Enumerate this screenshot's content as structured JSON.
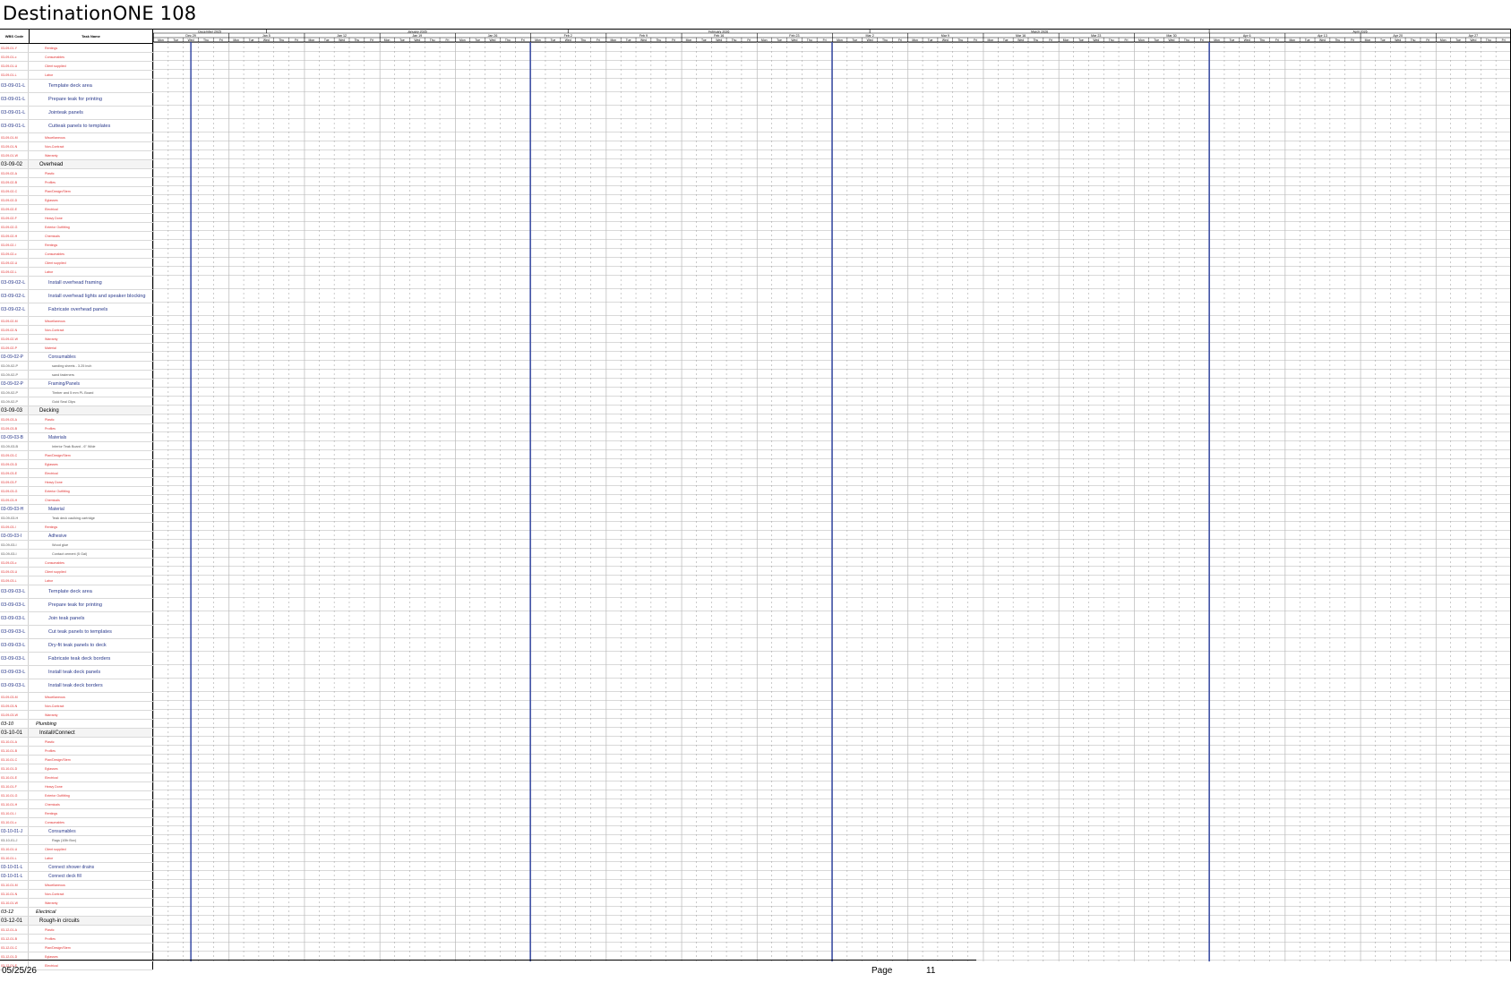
{
  "page_title": "DestinationONE 108",
  "left_header": {
    "wbs": "WBS Code",
    "task": "Task Name"
  },
  "rows": [
    {
      "wbs": "03-09-01-Y",
      "task": "Rentings",
      "style": "red"
    },
    {
      "wbs": "03-09-01-c",
      "task": "Consumables",
      "style": "red"
    },
    {
      "wbs": "03-09-01-U",
      "task": "Client supplied",
      "style": "red"
    },
    {
      "wbs": "03-09-01-L",
      "task": "Labor",
      "style": "red"
    },
    {
      "wbs": "03-09-01-L",
      "task": "Template deck area",
      "style": "blue"
    },
    {
      "wbs": "03-09-01-L",
      "task": "Prepare teak for printing",
      "style": "blue"
    },
    {
      "wbs": "03-09-01-L",
      "task": "Jointeak panels",
      "style": "blue"
    },
    {
      "wbs": "03-09-01-L",
      "task": "Cutteak panels to templates",
      "style": "blue"
    },
    {
      "wbs": "03-09-01-M",
      "task": "Miscellaneous",
      "style": "red"
    },
    {
      "wbs": "03-09-01-N",
      "task": "Non-Contract",
      "style": "red"
    },
    {
      "wbs": "03-09-01-W",
      "task": "Warranty",
      "style": "red"
    },
    {
      "wbs": "03-09-02",
      "task": "Overhead",
      "style": "head"
    },
    {
      "wbs": "03-09-02-A",
      "task": "Plastic",
      "style": "red"
    },
    {
      "wbs": "03-09-02-B",
      "task": "Profiles",
      "style": "red"
    },
    {
      "wbs": "03-09-02-C",
      "task": "Plan/Design/Stem",
      "style": "red"
    },
    {
      "wbs": "03-09-02-D",
      "task": "Eglasses",
      "style": "red"
    },
    {
      "wbs": "03-09-02-E",
      "task": "Electrical",
      "style": "red"
    },
    {
      "wbs": "03-09-02-F",
      "task": "Heavy Done",
      "style": "red"
    },
    {
      "wbs": "03-09-02-G",
      "task": "Exterior Outfitting",
      "style": "red"
    },
    {
      "wbs": "03-09-02-H",
      "task": "Chemicals",
      "style": "red"
    },
    {
      "wbs": "03-09-02-I",
      "task": "Rentings",
      "style": "red"
    },
    {
      "wbs": "03-09-02-c",
      "task": "Consumables",
      "style": "red"
    },
    {
      "wbs": "03-09-02-U",
      "task": "Client supplied",
      "style": "red"
    },
    {
      "wbs": "03-09-02-L",
      "task": "Labor",
      "style": "red"
    },
    {
      "wbs": "03-09-02-L",
      "task": "Install overhead framing",
      "style": "blue"
    },
    {
      "wbs": "03-09-02-L",
      "task": "Install overhead lights and speaker blocking",
      "style": "blue"
    },
    {
      "wbs": "03-09-02-L",
      "task": "Fabricate overhead panels",
      "style": "blue"
    },
    {
      "wbs": "03-09-02-M",
      "task": "Miscellaneous",
      "style": "red"
    },
    {
      "wbs": "03-09-02-N",
      "task": "Non-Contract",
      "style": "red"
    },
    {
      "wbs": "03-09-02-W",
      "task": "Warranty",
      "style": "red"
    },
    {
      "wbs": "03-09-02-P",
      "task": "Material",
      "style": "red"
    },
    {
      "wbs": "03-09-02-P",
      "task": "Consumables",
      "style": "group"
    },
    {
      "wbs": "03-09-02-P",
      "task": "sanding sheets - 3.25 inch",
      "style": "sub"
    },
    {
      "wbs": "03-09-02-P",
      "task": "sand fasteners",
      "style": "sub"
    },
    {
      "wbs": "03-09-02-P",
      "task": "Framing/Panels",
      "style": "group"
    },
    {
      "wbs": "03-09-02-P",
      "task": "Timber and 5 mm PL Board",
      "style": "sub"
    },
    {
      "wbs": "03-09-02-P",
      "task": "Gold Seal Clips",
      "style": "sub"
    },
    {
      "wbs": "03-09-03",
      "task": "Decking",
      "style": "head"
    },
    {
      "wbs": "03-09-03-A",
      "task": "Plastic",
      "style": "red"
    },
    {
      "wbs": "03-09-03-B",
      "task": "Profiles",
      "style": "red"
    },
    {
      "wbs": "03-09-03-B",
      "task": "Materials",
      "style": "group"
    },
    {
      "wbs": "03-09-03-B",
      "task": "Interior Teak Board - 6\" Wide",
      "style": "sub"
    },
    {
      "wbs": "03-09-03-C",
      "task": "Plan/Design/Stem",
      "style": "red"
    },
    {
      "wbs": "03-09-03-D",
      "task": "Eglasses",
      "style": "red"
    },
    {
      "wbs": "03-09-03-E",
      "task": "Electrical",
      "style": "red"
    },
    {
      "wbs": "03-09-03-F",
      "task": "Heavy Done",
      "style": "red"
    },
    {
      "wbs": "03-09-03-G",
      "task": "Exterior Outfitting",
      "style": "red"
    },
    {
      "wbs": "03-09-03-H",
      "task": "Chemicals",
      "style": "red"
    },
    {
      "wbs": "03-09-03-H",
      "task": "Material",
      "style": "group"
    },
    {
      "wbs": "03-09-03-H",
      "task": "Teak deck caulking cartridge",
      "style": "sub"
    },
    {
      "wbs": "03-09-03-I",
      "task": "Rentings",
      "style": "red"
    },
    {
      "wbs": "03-09-03-I",
      "task": "Adhesive",
      "style": "group"
    },
    {
      "wbs": "03-09-03-I",
      "task": "Wood glue",
      "style": "sub"
    },
    {
      "wbs": "03-09-03-I",
      "task": "Contact cement (5 Gal)",
      "style": "sub"
    },
    {
      "wbs": "03-09-03-c",
      "task": "Consumables",
      "style": "red"
    },
    {
      "wbs": "03-09-03-U",
      "task": "Client supplied",
      "style": "red"
    },
    {
      "wbs": "03-09-03-L",
      "task": "Labor",
      "style": "red"
    },
    {
      "wbs": "03-09-03-L",
      "task": "Template deck area",
      "style": "blue"
    },
    {
      "wbs": "03-09-03-L",
      "task": "Prepare teak for printing",
      "style": "blue"
    },
    {
      "wbs": "03-09-03-L",
      "task": "Join teak panels",
      "style": "blue"
    },
    {
      "wbs": "03-09-03-L",
      "task": "Cut teak panels to templates",
      "style": "blue"
    },
    {
      "wbs": "03-09-03-L",
      "task": "Dry-fit teak panels to deck",
      "style": "blue"
    },
    {
      "wbs": "03-09-03-L",
      "task": "Fabricate teak deck borders",
      "style": "blue"
    },
    {
      "wbs": "03-09-03-L",
      "task": "Install teak deck panels",
      "style": "blue"
    },
    {
      "wbs": "03-09-03-L",
      "task": "Install teak deck borders",
      "style": "blue"
    },
    {
      "wbs": "03-09-03-M",
      "task": "Miscellaneous",
      "style": "red"
    },
    {
      "wbs": "03-09-03-N",
      "task": "Non-Contract",
      "style": "red"
    },
    {
      "wbs": "03-09-03-W",
      "task": "Warranty",
      "style": "red"
    },
    {
      "wbs": "03-10",
      "task": "Plumbing",
      "style": "sect"
    },
    {
      "wbs": "03-10-01",
      "task": "Install/Connect",
      "style": "head"
    },
    {
      "wbs": "03-10-01-A",
      "task": "Plastic",
      "style": "red"
    },
    {
      "wbs": "03-10-01-B",
      "task": "Profiles",
      "style": "red"
    },
    {
      "wbs": "03-10-01-C",
      "task": "Plan/Design/Stem",
      "style": "red"
    },
    {
      "wbs": "03-10-01-D",
      "task": "Eglasses",
      "style": "red"
    },
    {
      "wbs": "03-10-01-E",
      "task": "Electrical",
      "style": "red"
    },
    {
      "wbs": "03-10-01-F",
      "task": "Heavy Done",
      "style": "red"
    },
    {
      "wbs": "03-10-01-G",
      "task": "Exterior Outfitting",
      "style": "red"
    },
    {
      "wbs": "03-10-01-H",
      "task": "Chemicals",
      "style": "red"
    },
    {
      "wbs": "03-10-01-I",
      "task": "Rentings",
      "style": "red"
    },
    {
      "wbs": "03-10-01-c",
      "task": "Consumables",
      "style": "red"
    },
    {
      "wbs": "03-10-01-J",
      "task": "Consumables",
      "style": "group"
    },
    {
      "wbs": "03-10-01-J",
      "task": "Rags (10lb Box)",
      "style": "sub"
    },
    {
      "wbs": "03-10-01-U",
      "task": "Client supplied",
      "style": "red"
    },
    {
      "wbs": "03-10-01-L",
      "task": "Labor",
      "style": "red"
    },
    {
      "wbs": "03-10-01-L",
      "task": "Connect shower drains",
      "style": "group"
    },
    {
      "wbs": "03-10-01-L",
      "task": "Connect deck fill",
      "style": "group"
    },
    {
      "wbs": "03-10-01-M",
      "task": "Miscellaneous",
      "style": "red"
    },
    {
      "wbs": "03-10-01-N",
      "task": "Non-Contract",
      "style": "red"
    },
    {
      "wbs": "03-10-01-W",
      "task": "Warranty",
      "style": "red"
    },
    {
      "wbs": "03-12",
      "task": "Electrical",
      "style": "sect"
    },
    {
      "wbs": "03-12-01",
      "task": "Rough-in circuits",
      "style": "head"
    },
    {
      "wbs": "03-12-01-A",
      "task": "Plastic",
      "style": "red"
    },
    {
      "wbs": "03-12-01-B",
      "task": "Profiles",
      "style": "red"
    },
    {
      "wbs": "03-12-01-C",
      "task": "Plan/Design/Stem",
      "style": "red"
    },
    {
      "wbs": "03-12-01-D",
      "task": "Eglasses",
      "style": "red"
    },
    {
      "wbs": "03-12-01-E",
      "task": "Electrical",
      "style": "red"
    }
  ],
  "timeline": {
    "months": [
      {
        "label": "December 2025",
        "weeks": 1.5
      },
      {
        "label": "January 2026",
        "weeks": 4
      },
      {
        "label": "February 2026",
        "weeks": 4
      },
      {
        "label": "March 2026",
        "weeks": 4.5
      },
      {
        "label": "April 2026",
        "weeks": 4
      }
    ],
    "weeks": [
      "Dec 29",
      "Jan 5",
      "Jan 12",
      "Jan 19",
      "Jan 26",
      "Feb 2",
      "Feb 9",
      "Feb 16",
      "Feb 23",
      "Mar 2",
      "Mar 9",
      "Mar 16",
      "Mar 23",
      "Mar 30",
      "Apr 6",
      "Apr 13",
      "Apr 20",
      "Apr 27"
    ],
    "days": [
      "Mon",
      "Tue",
      "Wed",
      "Thu",
      "Fri"
    ],
    "divider_weeks_after": [
      0,
      4,
      8,
      13
    ],
    "divider_color": "#2b3fa0"
  },
  "footer": {
    "date": "05/25/26",
    "page_label": "Page",
    "page_number": "11"
  }
}
